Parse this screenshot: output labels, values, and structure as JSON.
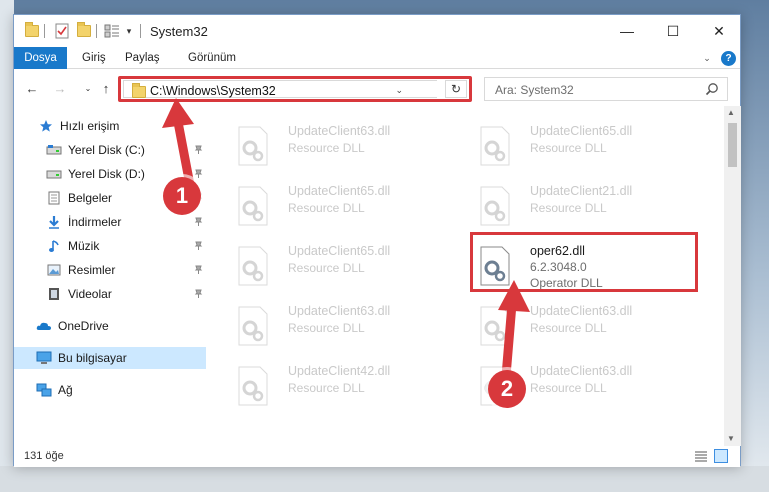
{
  "window": {
    "title": "System32",
    "minimize": "—",
    "maximize": "☐",
    "close": "✕",
    "qa_dropdown": "▾"
  },
  "ribbon": {
    "tabs": [
      "Dosya",
      "Giriş",
      "Paylaş",
      "Görünüm"
    ],
    "expand": "⌄",
    "help": "?"
  },
  "nav": {
    "back": "←",
    "forward": "→",
    "recent": "⌄",
    "up": "↑",
    "address": "C:\\Windows\\System32",
    "address_dropdown": "⌄",
    "refresh": "↻",
    "search_placeholder": "Ara: System32"
  },
  "sidebar": {
    "items": [
      {
        "label": "Hızlı erişim",
        "icon": "star-icon"
      },
      {
        "label": "Yerel Disk (C:)",
        "icon": "drive-icon",
        "pinned": true
      },
      {
        "label": "Yerel Disk (D:)",
        "icon": "drive-icon",
        "pinned": true
      },
      {
        "label": "Belgeler",
        "icon": "document-icon",
        "pinned": true
      },
      {
        "label": "İndirmeler",
        "icon": "download-icon",
        "pinned": true
      },
      {
        "label": "Müzik",
        "icon": "music-icon",
        "pinned": true
      },
      {
        "label": "Resimler",
        "icon": "pictures-icon",
        "pinned": true
      },
      {
        "label": "Videolar",
        "icon": "video-icon",
        "pinned": true
      },
      {
        "label": "OneDrive",
        "icon": "cloud-icon"
      },
      {
        "label": "Bu bilgisayar",
        "icon": "computer-icon",
        "selected": true
      },
      {
        "label": "Ağ",
        "icon": "network-icon"
      }
    ]
  },
  "files": [
    {
      "name": "UpdateClient63.dll",
      "type": "Resource DLL",
      "dim": true
    },
    {
      "name": "UpdateClient65.dll",
      "type": "Resource DLL",
      "dim": true
    },
    {
      "name": "UpdateClient65.dll",
      "type": "Resource DLL",
      "dim": true
    },
    {
      "name": "UpdateClient21.dll",
      "type": "Resource DLL",
      "dim": true
    },
    {
      "name": "UpdateClient65.dll",
      "type": "Resource DLL",
      "dim": true
    },
    {
      "name": "oper62.dll",
      "version": "6.2.3048.0",
      "type": "Operator DLL",
      "dim": false
    },
    {
      "name": "UpdateClient63.dll",
      "type": "Resource DLL",
      "dim": true
    },
    {
      "name": "UpdateClient63.dll",
      "type": "Resource DLL",
      "dim": true
    },
    {
      "name": "UpdateClient42.dll",
      "type": "Resource DLL",
      "dim": true
    },
    {
      "name": "UpdateClient63.dll",
      "type": "Resource DLL",
      "dim": true
    }
  ],
  "status": {
    "count": "131 öğe"
  },
  "annotations": {
    "step1": "1",
    "step2": "2"
  },
  "colors": {
    "accent": "#1979ca",
    "highlight_red": "#d8383c",
    "selection": "#cce8ff"
  }
}
